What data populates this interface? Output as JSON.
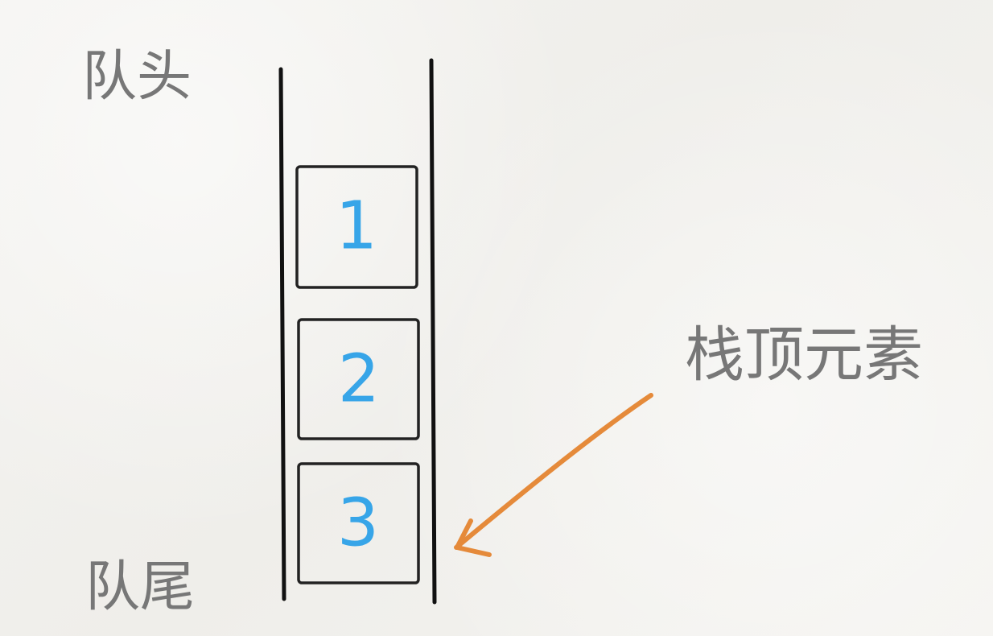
{
  "labels": {
    "head": "队头",
    "tail": "队尾",
    "top_element": "栈顶元素"
  },
  "items": [
    "1",
    "2",
    "3"
  ],
  "colors": {
    "background": "#f3f2ef",
    "text_gray": "#777777",
    "outline": "#111111",
    "number_blue": "#37a5e8",
    "arrow_orange": "#e58a3a"
  }
}
